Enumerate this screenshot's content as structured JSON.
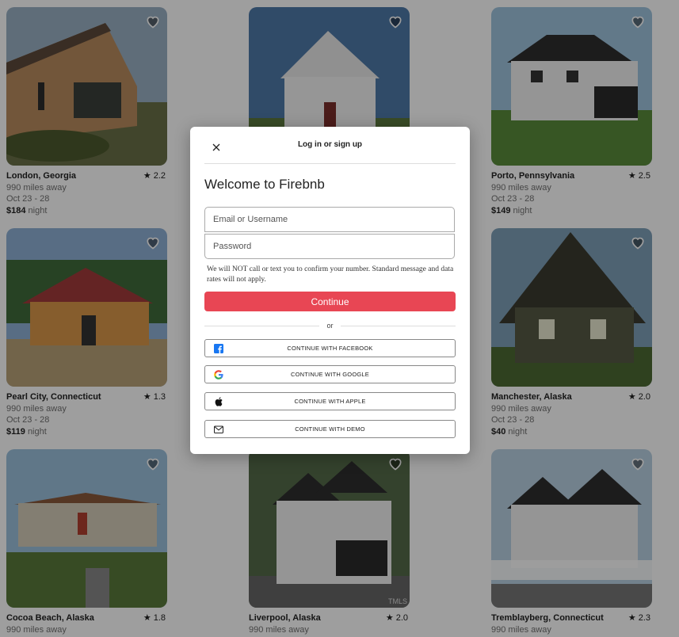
{
  "listings": [
    {
      "location": "London, Georgia",
      "rating": "2.2",
      "distance": "990 miles away",
      "dates": "Oct 23 - 28",
      "price": "$184",
      "price_unit": "night"
    },
    {
      "location": "",
      "rating": "",
      "distance": "",
      "dates": "",
      "price": "",
      "price_unit": ""
    },
    {
      "location": "Porto, Pennsylvania",
      "rating": "2.5",
      "distance": "990 miles away",
      "dates": "Oct 23 - 28",
      "price": "$149",
      "price_unit": "night"
    },
    {
      "location": "Pearl City, Connecticut",
      "rating": "1.3",
      "distance": "990 miles away",
      "dates": "Oct 23 - 28",
      "price": "$119",
      "price_unit": "night"
    },
    {
      "location": "",
      "rating": "",
      "distance": "",
      "dates": "",
      "price": "",
      "price_unit": ""
    },
    {
      "location": "Manchester, Alaska",
      "rating": "2.0",
      "distance": "990 miles away",
      "dates": "Oct 23 - 28",
      "price": "$40",
      "price_unit": "night"
    },
    {
      "location": "Cocoa Beach, Alaska",
      "rating": "1.8",
      "distance": "990 miles away",
      "dates": "",
      "price": "",
      "price_unit": ""
    },
    {
      "location": "Liverpool, Alaska",
      "rating": "2.0",
      "distance": "990 miles away",
      "dates": "",
      "price": "",
      "price_unit": ""
    },
    {
      "location": "Tremblayberg, Connecticut",
      "rating": "2.3",
      "distance": "990 miles away",
      "dates": "",
      "price": "",
      "price_unit": ""
    }
  ],
  "photo_watermark": "TMLS",
  "modal": {
    "title": "Log in or sign up",
    "welcome": "Welcome to Firebnb",
    "email_placeholder": "Email or Username",
    "password_placeholder": "Password",
    "disclaimer": "We will NOT call or text you to confirm your number. Standard message and data rates will not apply.",
    "continue_label": "Continue",
    "or_label": "or",
    "social": [
      {
        "label": "CONTINUE WITH FACEBOOK",
        "icon": "facebook-icon"
      },
      {
        "label": "CONTINUE WITH GOOGLE",
        "icon": "google-icon"
      },
      {
        "label": "CONTINUE WITH APPLE",
        "icon": "apple-icon"
      },
      {
        "label": "CONTINUE WITH DEMO",
        "icon": "mail-icon"
      }
    ]
  },
  "colors": {
    "accent": "#e84654",
    "overlay": "rgba(0,0,0,0.38)",
    "facebook": "#1877f2"
  }
}
